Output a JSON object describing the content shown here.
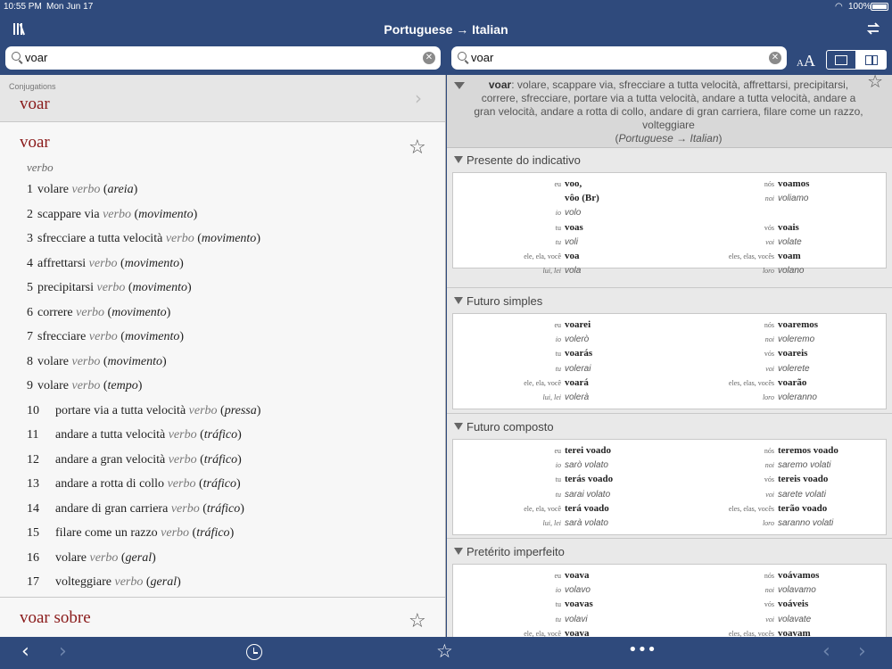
{
  "status": {
    "time": "10:55 PM",
    "date": "Mon Jun 17",
    "battery": "100%"
  },
  "header": {
    "title": "Portuguese → Italian"
  },
  "search_left": {
    "value": "voar"
  },
  "search_right": {
    "value": "voar"
  },
  "conjugations": {
    "label": "Conjugations",
    "word": "voar"
  },
  "entry": {
    "headword": "voar",
    "pos": "verbo",
    "senses": [
      {
        "num": "1",
        "text": "volare",
        "pos": "verbo",
        "domain": "areia"
      },
      {
        "num": "2",
        "text": "scappare via",
        "pos": "verbo",
        "domain": "movimento"
      },
      {
        "num": "3",
        "text": "sfrecciare a tutta velocità",
        "pos": "verbo",
        "domain": "movimento"
      },
      {
        "num": "4",
        "text": "affrettarsi",
        "pos": "verbo",
        "domain": "movimento"
      },
      {
        "num": "5",
        "text": "precipitarsi",
        "pos": "verbo",
        "domain": "movimento"
      },
      {
        "num": "6",
        "text": "correre",
        "pos": "verbo",
        "domain": "movimento"
      },
      {
        "num": "7",
        "text": "sfrecciare",
        "pos": "verbo",
        "domain": "movimento"
      },
      {
        "num": "8",
        "text": "volare",
        "pos": "verbo",
        "domain": "movimento"
      },
      {
        "num": "9",
        "text": "volare",
        "pos": "verbo",
        "domain": "tempo"
      },
      {
        "num": "10",
        "text": "portare via a tutta velocità",
        "pos": "verbo",
        "domain": "pressa"
      },
      {
        "num": "11",
        "text": "andare a tutta velocità",
        "pos": "verbo",
        "domain": "tráfico"
      },
      {
        "num": "12",
        "text": "andare a gran velocità",
        "pos": "verbo",
        "domain": "tráfico"
      },
      {
        "num": "13",
        "text": "andare a rotta di collo",
        "pos": "verbo",
        "domain": "tráfico"
      },
      {
        "num": "14",
        "text": "andare di gran carriera",
        "pos": "verbo",
        "domain": "tráfico"
      },
      {
        "num": "15",
        "text": "filare come un razzo",
        "pos": "verbo",
        "domain": "tráfico"
      },
      {
        "num": "16",
        "text": "volare",
        "pos": "verbo",
        "domain": "geral"
      },
      {
        "num": "17",
        "text": "volteggiare",
        "pos": "verbo",
        "domain": "geral"
      }
    ]
  },
  "entry2": {
    "headword": "voar sobre"
  },
  "summary": {
    "word": "voar",
    "text": ": volare, scappare via, sfrecciare a tutta velocità, affrettarsi, precipitarsi, correre, sfrecciare, portare via a tutta velocità, andare a tutta velocità, andare a gran velocità, andare a rotta di collo, andare di gran carriera, filare come un razzo, volteggiare",
    "direction": "Portuguese → Italian"
  },
  "tenses": [
    {
      "name": "Presente do indicativo",
      "rows": [
        {
          "l_pr": "eu",
          "l_fm": "voo,",
          "r_pr": "nós",
          "r_fm": "voamos"
        },
        {
          "l_pr": "",
          "l_fm": "vôo (Br)",
          "r_pr": "noi",
          "r_fm": "voliamo",
          "r_it": true
        },
        {
          "l_pr": "io",
          "l_fm": "volo",
          "l_it": true,
          "r_pr": "",
          "r_fm": ""
        },
        {
          "l_pr": "tu",
          "l_fm": "voas",
          "r_pr": "vós",
          "r_fm": "voais"
        },
        {
          "l_pr": "tu",
          "l_fm": "voli",
          "l_it": true,
          "r_pr": "voi",
          "r_fm": "volate",
          "r_it": true
        },
        {
          "l_pr": "ele, ela, você",
          "l_fm": "voa",
          "r_pr": "eles, elas, vocês",
          "r_fm": "voam"
        },
        {
          "l_pr": "lui, lei",
          "l_fm": "vola",
          "l_it": true,
          "r_pr": "loro",
          "r_fm": "volano",
          "r_it": true
        }
      ]
    },
    {
      "name": "Futuro simples",
      "rows": [
        {
          "l_pr": "eu",
          "l_fm": "voarei",
          "r_pr": "nós",
          "r_fm": "voaremos"
        },
        {
          "l_pr": "io",
          "l_fm": "volerò",
          "l_it": true,
          "r_pr": "noi",
          "r_fm": "voleremo",
          "r_it": true
        },
        {
          "l_pr": "tu",
          "l_fm": "voarás",
          "r_pr": "vós",
          "r_fm": "voareis"
        },
        {
          "l_pr": "tu",
          "l_fm": "volerai",
          "l_it": true,
          "r_pr": "voi",
          "r_fm": "volerete",
          "r_it": true
        },
        {
          "l_pr": "ele, ela, você",
          "l_fm": "voará",
          "r_pr": "eles, elas, vocês",
          "r_fm": "voarão"
        },
        {
          "l_pr": "lui, lei",
          "l_fm": "volerà",
          "l_it": true,
          "r_pr": "loro",
          "r_fm": "voleranno",
          "r_it": true
        }
      ]
    },
    {
      "name": "Futuro composto",
      "rows": [
        {
          "l_pr": "eu",
          "l_fm": "terei voado",
          "r_pr": "nós",
          "r_fm": "teremos voado"
        },
        {
          "l_pr": "io",
          "l_fm": "sarò volato",
          "l_it": true,
          "r_pr": "noi",
          "r_fm": "saremo volati",
          "r_it": true
        },
        {
          "l_pr": "tu",
          "l_fm": "terás voado",
          "r_pr": "vós",
          "r_fm": "tereis voado"
        },
        {
          "l_pr": "tu",
          "l_fm": "sarai volato",
          "l_it": true,
          "r_pr": "voi",
          "r_fm": "sarete volati",
          "r_it": true
        },
        {
          "l_pr": "ele, ela, você",
          "l_fm": "terá voado",
          "r_pr": "eles, elas, vocês",
          "r_fm": "terão voado"
        },
        {
          "l_pr": "lui, lei",
          "l_fm": "sarà volato",
          "l_it": true,
          "r_pr": "loro",
          "r_fm": "saranno volati",
          "r_it": true
        }
      ]
    },
    {
      "name": "Pretérito imperfeito",
      "rows": [
        {
          "l_pr": "eu",
          "l_fm": "voava",
          "r_pr": "nós",
          "r_fm": "voávamos"
        },
        {
          "l_pr": "io",
          "l_fm": "volavo",
          "l_it": true,
          "r_pr": "noi",
          "r_fm": "volavamo",
          "r_it": true
        },
        {
          "l_pr": "tu",
          "l_fm": "voavas",
          "r_pr": "vós",
          "r_fm": "voáveis"
        },
        {
          "l_pr": "tu",
          "l_fm": "volavi",
          "l_it": true,
          "r_pr": "voi",
          "r_fm": "volavate",
          "r_it": true
        },
        {
          "l_pr": "ele, ela, você",
          "l_fm": "voava",
          "r_pr": "eles, elas, vocês",
          "r_fm": "voavam"
        }
      ]
    }
  ],
  "icons": {
    "library": "library-icon",
    "swap": "swap-icon",
    "font_size": "font-size-icon",
    "single_pane": "single-pane-icon",
    "split_pane": "split-pane-icon",
    "back": "back-icon",
    "forward": "forward-icon",
    "history": "history-icon",
    "favorites": "star-icon",
    "more": "more-icon"
  },
  "colors": {
    "bar": "#2f4a7c",
    "headword": "#8a1a1a"
  }
}
